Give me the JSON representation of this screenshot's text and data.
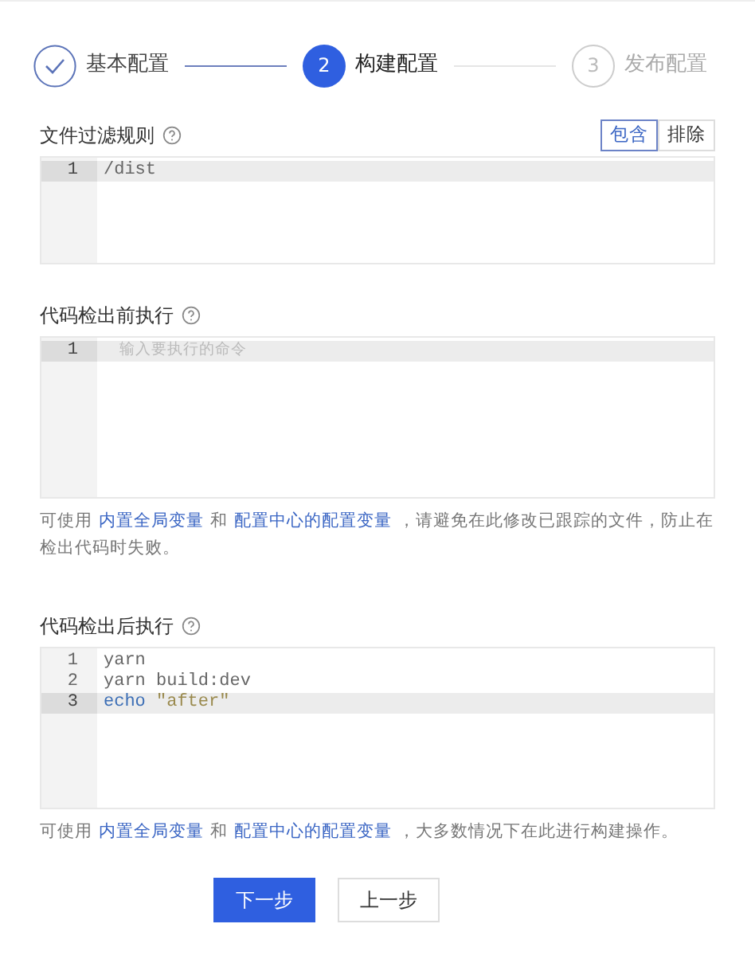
{
  "steps": [
    {
      "label": "基本配置",
      "done": true,
      "selected": false
    },
    {
      "number": "2",
      "label": "构建配置",
      "done": false,
      "selected": true
    },
    {
      "number": "3",
      "label": "发布配置",
      "done": false,
      "selected": false
    }
  ],
  "sections": [
    {
      "label": "文件过滤规则",
      "mode_buttons": [
        {
          "label": "包含",
          "selected": true
        },
        {
          "label": "排除",
          "selected": false
        }
      ],
      "editor": {
        "lines": [
          {
            "number": "1",
            "selected": true,
            "tokens": [
              {
                "kind": "plain",
                "text": "/dist"
              }
            ]
          }
        ]
      }
    },
    {
      "label": "代码检出前执行",
      "editor": {
        "placeholder": "输入要执行的命令",
        "lines": [
          {
            "number": "1",
            "selected": true
          }
        ]
      },
      "help": [
        {
          "kind": "text",
          "text": "可使用"
        },
        {
          "kind": "link",
          "text": "内置全局变量"
        },
        {
          "kind": "text",
          "text": "和"
        },
        {
          "kind": "link",
          "text": "配置中心的配置变量"
        },
        {
          "kind": "text",
          "text": "，请避免在此修改已跟踪的文件，防止在检出代码时失败。"
        }
      ]
    },
    {
      "label": "代码检出后执行",
      "editor": {
        "lines": [
          {
            "number": "1",
            "selected": false,
            "tokens": [
              {
                "kind": "plain",
                "text": "yarn"
              }
            ]
          },
          {
            "number": "2",
            "selected": false,
            "tokens": [
              {
                "kind": "plain",
                "text": "yarn build:dev"
              }
            ]
          },
          {
            "number": "3",
            "selected": true,
            "tokens": [
              {
                "kind": "keyword",
                "text": "echo"
              },
              {
                "kind": "string",
                "text": "\"after\""
              }
            ]
          }
        ]
      },
      "help": [
        {
          "kind": "text",
          "text": "可使用"
        },
        {
          "kind": "link",
          "text": "内置全局变量"
        },
        {
          "kind": "text",
          "text": "和"
        },
        {
          "kind": "link",
          "text": "配置中心的配置变量"
        },
        {
          "kind": "text",
          "text": "，大多数情况下在此进行构建操作。"
        }
      ]
    }
  ],
  "buttons": [
    {
      "label": "下一步",
      "kind": "primary"
    },
    {
      "label": "上一步",
      "kind": "default"
    }
  ]
}
